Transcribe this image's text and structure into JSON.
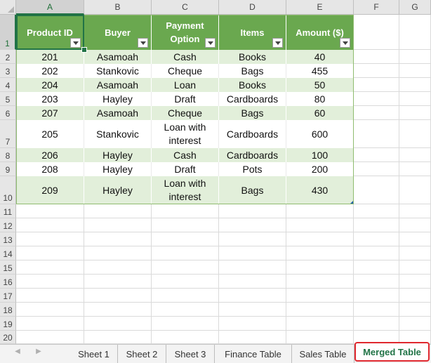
{
  "columns": [
    "A",
    "B",
    "C",
    "D",
    "E",
    "F",
    "G"
  ],
  "rows": [
    "1",
    "2",
    "3",
    "4",
    "5",
    "6",
    "7",
    "8",
    "9",
    "10",
    "11",
    "12",
    "13",
    "14",
    "15",
    "16",
    "17",
    "18",
    "19",
    "20"
  ],
  "table": {
    "headers": [
      "Product ID",
      "Buyer",
      "Payment Option",
      "Items",
      "Amount ($)"
    ],
    "header_lines": [
      [
        "Product ID"
      ],
      [
        "Buyer"
      ],
      [
        "Payment",
        "Option"
      ],
      [
        "Items"
      ],
      [
        "Amount ($)"
      ]
    ],
    "records": [
      {
        "id": "201",
        "buyer": "Asamoah",
        "payment": [
          "Cash"
        ],
        "item": "Books",
        "amount": "40"
      },
      {
        "id": "202",
        "buyer": "Stankovic",
        "payment": [
          "Cheque"
        ],
        "item": "Bags",
        "amount": "455"
      },
      {
        "id": "204",
        "buyer": "Asamoah",
        "payment": [
          "Loan"
        ],
        "item": "Books",
        "amount": "50"
      },
      {
        "id": "203",
        "buyer": "Hayley",
        "payment": [
          "Draft"
        ],
        "item": "Cardboards",
        "amount": "80"
      },
      {
        "id": "207",
        "buyer": "Asamoah",
        "payment": [
          "Cheque"
        ],
        "item": "Bags",
        "amount": "60"
      },
      {
        "id": "205",
        "buyer": "Stankovic",
        "payment": [
          "Loan with",
          "interest"
        ],
        "item": "Cardboards",
        "amount": "600"
      },
      {
        "id": "206",
        "buyer": "Hayley",
        "payment": [
          "Cash"
        ],
        "item": "Cardboards",
        "amount": "100"
      },
      {
        "id": "208",
        "buyer": "Hayley",
        "payment": [
          "Draft"
        ],
        "item": "Pots",
        "amount": "200"
      },
      {
        "id": "209",
        "buyer": "Hayley",
        "payment": [
          "Loan with",
          "interest"
        ],
        "item": "Bags",
        "amount": "430"
      }
    ]
  },
  "selected_cell": "A1",
  "sheet_tabs": [
    "Sheet 1",
    "Sheet 2",
    "Sheet 3",
    "Finance Table",
    "Sales Table",
    "Merged Table"
  ],
  "active_tab": "Merged Table",
  "colors": {
    "header_green": "#6aa84f",
    "band_green": "#e2efda",
    "excel_green": "#217346",
    "tab_highlight": "#e0282f"
  }
}
